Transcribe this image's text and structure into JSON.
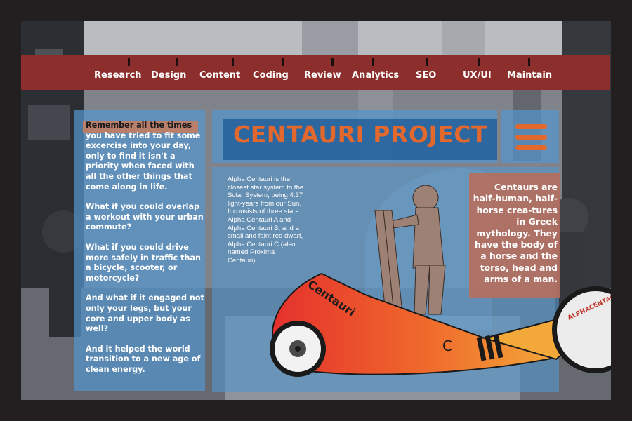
{
  "nav": {
    "items": [
      "Research",
      "Design",
      "Content",
      "Coding",
      "Review",
      "Analytics",
      "SEO",
      "UX/UI",
      "Maintain"
    ]
  },
  "left_panel": {
    "highlight": "Remember all the times",
    "p1": "you have tried to fit some excercise into your day, only to find it isn't a priority when faced with all the other things that come along in life.",
    "p2": "What if you could overlap a workout with your urban commute?",
    "p3": "What if you could drive more safely in traffic than a bicycle, scooter, or motorcycle?",
    "p4": "And what if it engaged not only your legs, but your core and upper body as well?",
    "p5": "And it helped the world transition to a new age of clean energy."
  },
  "header": {
    "title": "CENTAURI PROJECT"
  },
  "center_text": "Alpha Centauri is the closest star system to the Solar System, being 4.37 light-years from our Sun. It consists of three stars: Alpha Centauri A and Alpha Centauri B, and a small and faint red dwarf, Alpha Centauri C (also named Proxima Centauri).",
  "right_text": "Centaurs are half-human, half-horse crea-tures in Greek mythology. They have the body of a horse and the torso, head and arms of a man.",
  "vehicle": {
    "side_label": "Centauri",
    "body_letter": "C",
    "wheel_label": "ALPHACENTAURI"
  },
  "colors": {
    "frame": "#231f20",
    "nav_bar": "#8c2f2c",
    "panel_blue": "#5496cd",
    "accent_orange": "#e2682d",
    "right_box": "#b66e5c"
  }
}
